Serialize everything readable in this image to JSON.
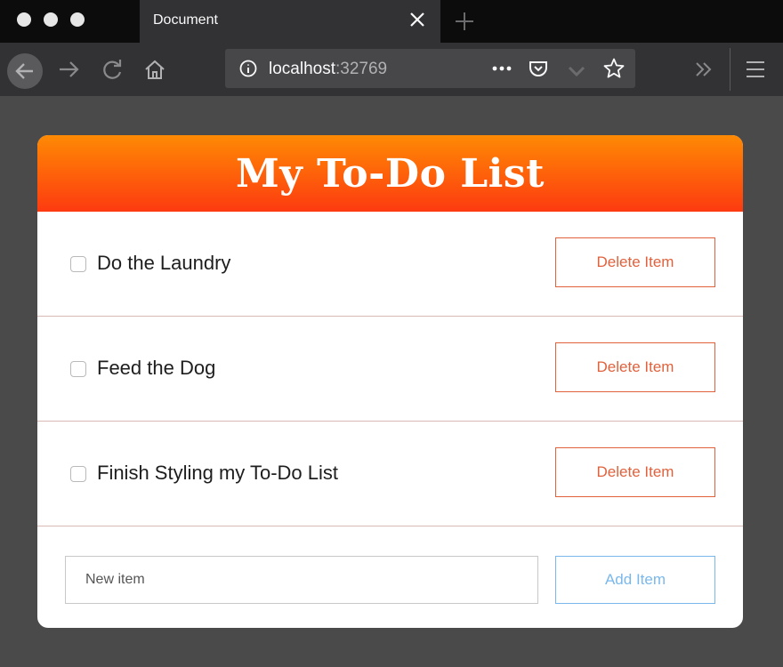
{
  "browser": {
    "tab_title": "Document",
    "url_host": "localhost",
    "url_port": ":32769",
    "icons": {
      "close": "close-icon",
      "new_tab": "plus-icon",
      "back": "back-arrow-icon",
      "forward": "forward-arrow-icon",
      "reload": "reload-icon",
      "home": "home-icon",
      "info": "info-icon",
      "more": "ellipsis-icon",
      "pocket": "pocket-icon",
      "bookmark": "star-icon",
      "overflow": "double-chevron-icon",
      "menu": "hamburger-menu-icon"
    },
    "colors": {
      "chrome_dark": "#0c0c0d",
      "chrome": "#323234",
      "urlbar": "#474749"
    }
  },
  "page": {
    "title": "My To-Do List",
    "items": [
      {
        "label": "Do the Laundry",
        "checked": false,
        "delete_label": "Delete Item"
      },
      {
        "label": "Feed the Dog",
        "checked": false,
        "delete_label": "Delete Item"
      },
      {
        "label": "Finish Styling my To-Do List",
        "checked": false,
        "delete_label": "Delete Item"
      }
    ],
    "new_item": {
      "placeholder": "New item",
      "value": ""
    },
    "add_label": "Add Item",
    "colors": {
      "header_top": "#fe8a04",
      "header_bottom": "#fd3a10",
      "delete": "#e1613c",
      "add": "#7ab8ec"
    }
  }
}
